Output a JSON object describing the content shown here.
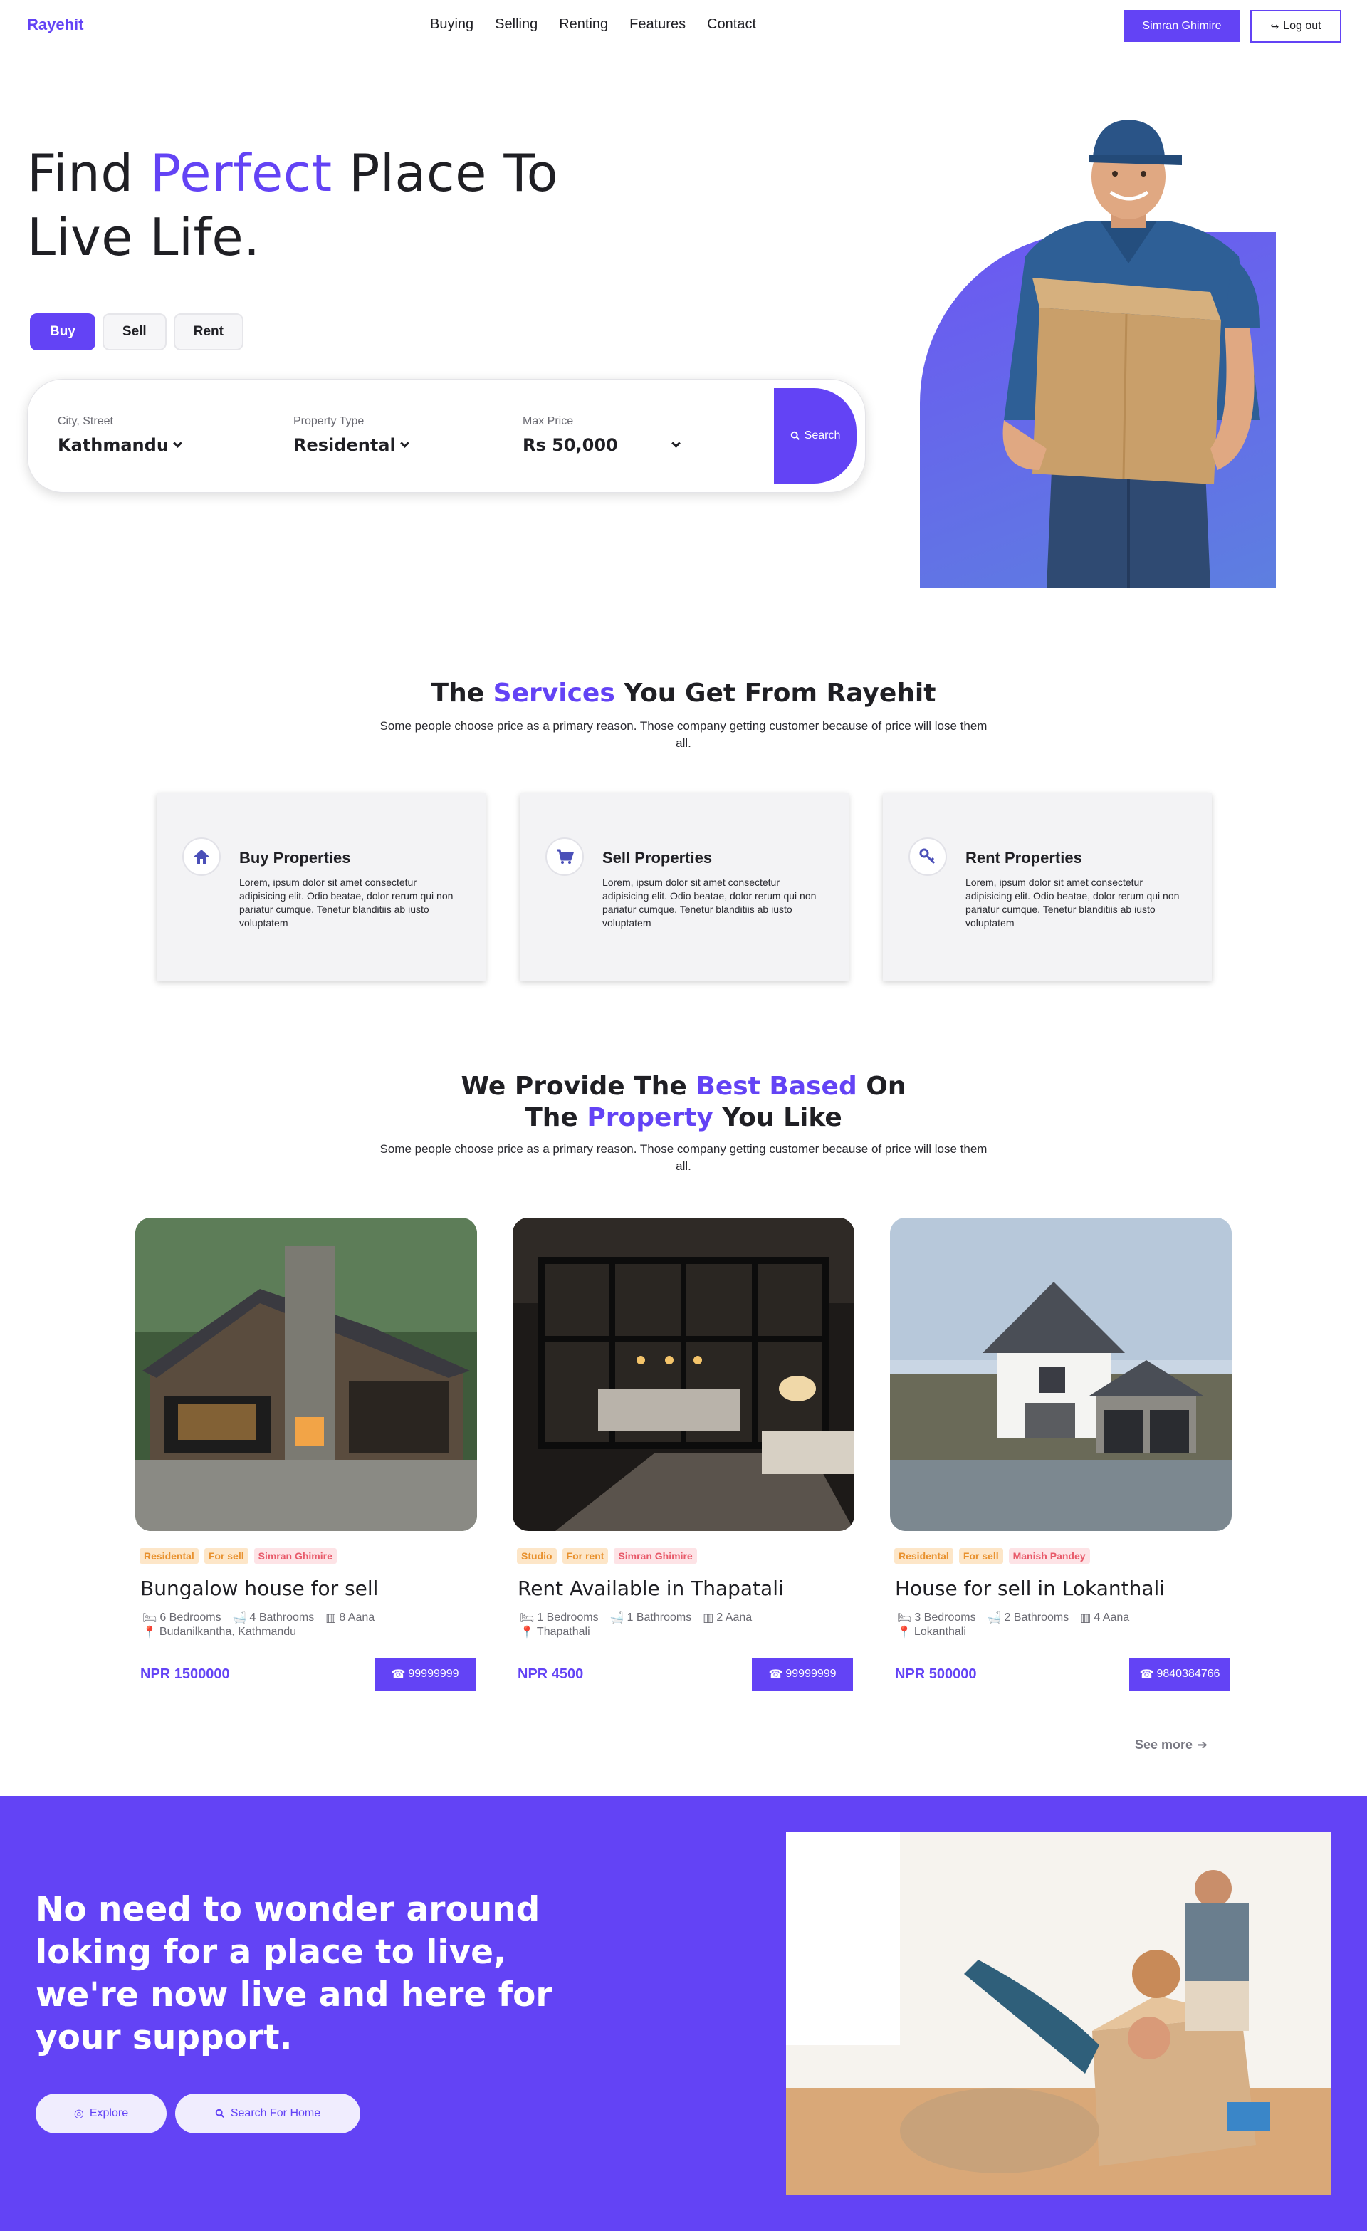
{
  "nav": {
    "brand": "Rayehit",
    "links": [
      "Buying",
      "Selling",
      "Renting",
      "Features",
      "Contact"
    ],
    "user_button": "Simran Ghimire",
    "logout_button": "Log out"
  },
  "hero": {
    "title_part1": "Find ",
    "title_accent": "Perfect",
    "title_part2": " Place To Live Life.",
    "tabs": [
      "Buy",
      "Sell",
      "Rent"
    ],
    "active_tab": "Buy",
    "search": {
      "city_label": "City, Street",
      "city_value": "Kathmandu",
      "type_label": "Property Type",
      "type_value": "Residental",
      "price_label": "Max Price",
      "price_value": "Rs 50,000",
      "button": "Search"
    }
  },
  "services": {
    "title_part1": "The ",
    "title_accent": "Services",
    "title_part2": " You Get From Rayehit",
    "subtitle": "Some people choose price as a primary reason. Those company getting customer because of price will lose them all.",
    "items": [
      {
        "icon": "home-icon",
        "title": "Buy Properties",
        "text": "Lorem, ipsum dolor sit amet consectetur adipisicing elit. Odio beatae, dolor rerum qui non pariatur cumque. Tenetur blanditiis ab iusto voluptatem"
      },
      {
        "icon": "cart-icon",
        "title": "Sell Properties",
        "text": "Lorem, ipsum dolor sit amet consectetur adipisicing elit. Odio beatae, dolor rerum qui non pariatur cumque. Tenetur blanditiis ab iusto voluptatem"
      },
      {
        "icon": "key-icon",
        "title": "Rent Properties",
        "text": "Lorem, ipsum dolor sit amet consectetur adipisicing elit. Odio beatae, dolor rerum qui non pariatur cumque. Tenetur blanditiis ab iusto voluptatem"
      }
    ]
  },
  "properties": {
    "title_line1_part1": "We Provide The ",
    "title_line1_accent": "Best Based",
    "title_line1_part2": " On",
    "title_line2_part1": "The ",
    "title_line2_accent": "Property",
    "title_line2_part2": " You Like",
    "subtitle": "Some people choose price as a primary reason. Those company getting customer because of price will lose them all.",
    "items": [
      {
        "tags": [
          "Residental",
          "For sell",
          "Simran Ghimire"
        ],
        "title": "Bungalow house for sell",
        "bedrooms": "6 Bedrooms",
        "bathrooms": "4 Bathrooms",
        "area": "8 Aana",
        "location": "Budanilkantha, Kathmandu",
        "price": "NPR 1500000",
        "phone": "99999999"
      },
      {
        "tags": [
          "Studio",
          "For rent",
          "Simran Ghimire"
        ],
        "title": "Rent Available in Thapatali",
        "bedrooms": "1 Bedrooms",
        "bathrooms": "1 Bathrooms",
        "area": "2 Aana",
        "location": "Thapathali",
        "price": "NPR 4500",
        "phone": "99999999"
      },
      {
        "tags": [
          "Residental",
          "For sell",
          "Manish Pandey"
        ],
        "title": "House for sell in Lokanthali",
        "bedrooms": "3 Bedrooms",
        "bathrooms": "2 Bathrooms",
        "area": "4 Aana",
        "location": "Lokanthali",
        "price": "NPR 500000",
        "phone": "9840384766"
      }
    ],
    "see_more": "See more"
  },
  "band": {
    "title": "No need to wonder around loking for a place to live, we're now live and here for your support.",
    "explore_button": "Explore",
    "search_button": "Search For Home"
  },
  "colors": {
    "accent": "#6343f5",
    "tag_orange": "#e8912e",
    "tag_red": "#e85a6a"
  }
}
